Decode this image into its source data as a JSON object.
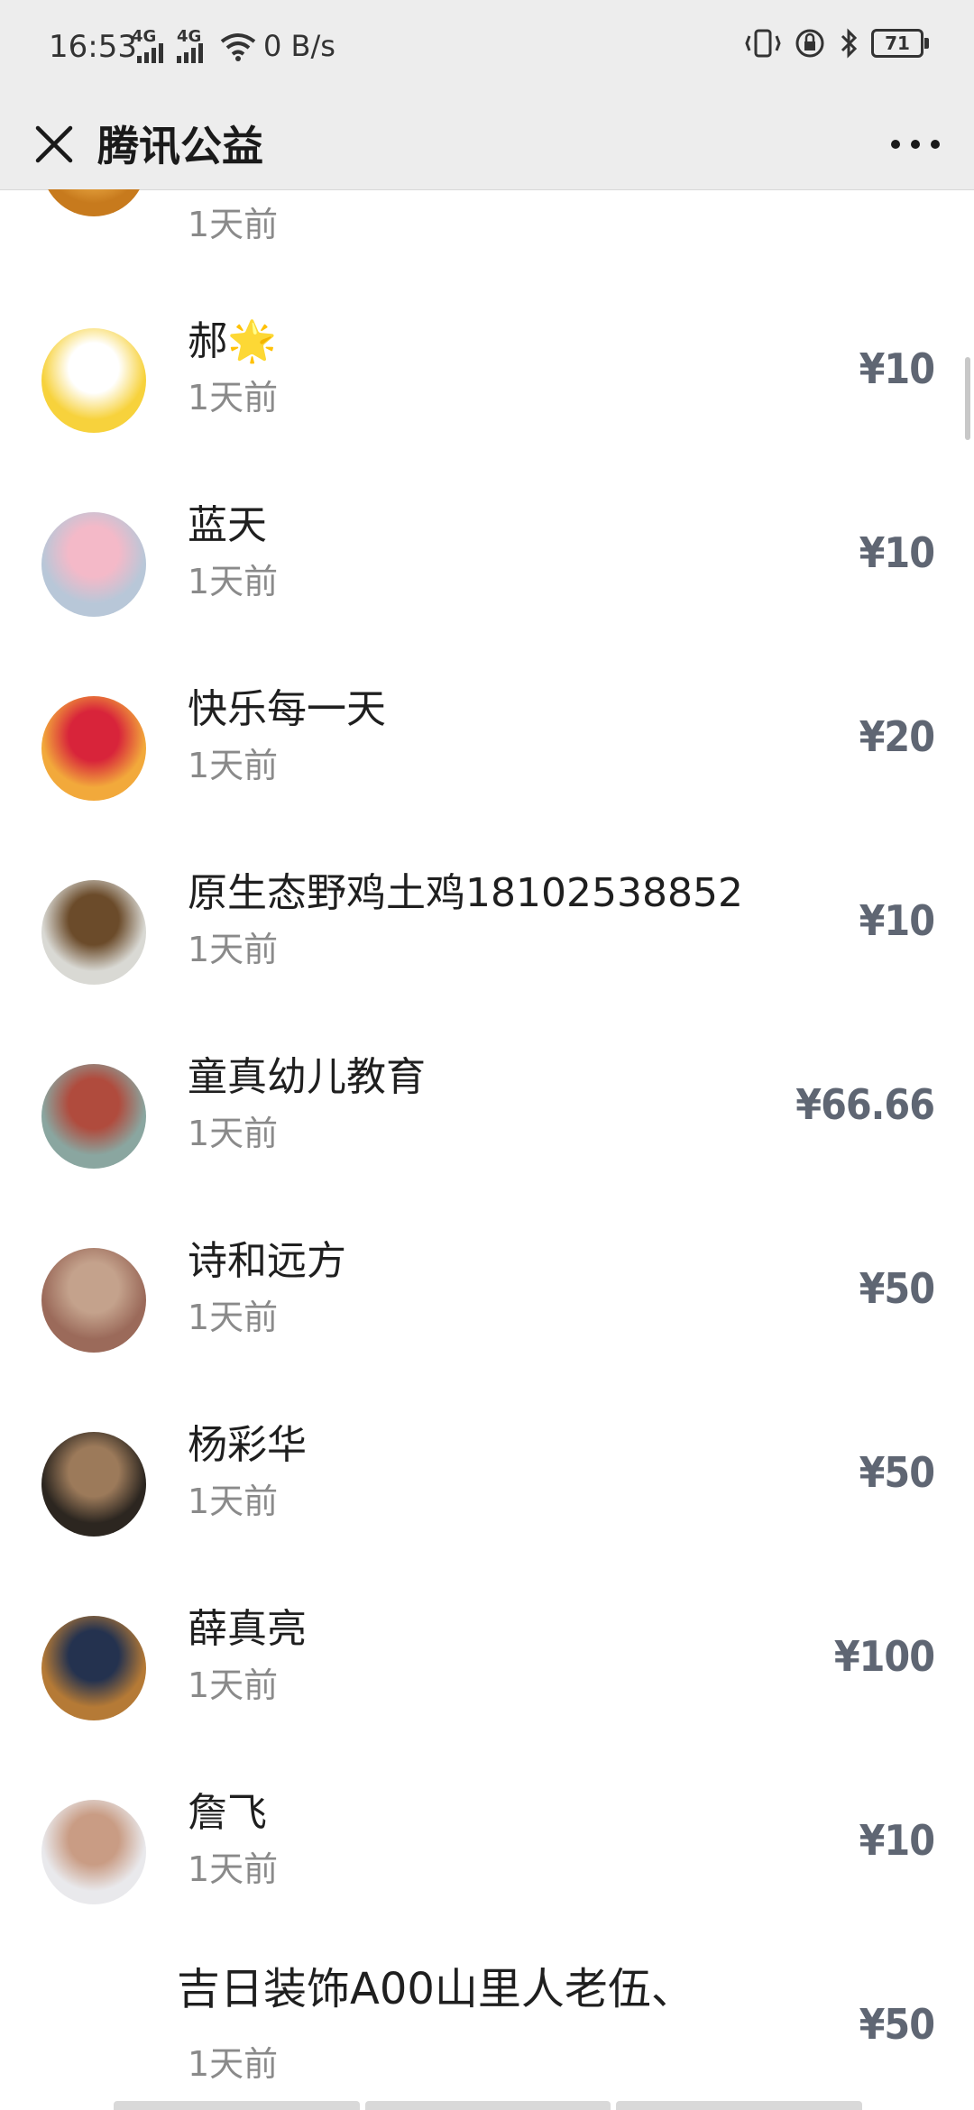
{
  "status_bar": {
    "time": "16:53",
    "network1": "4G",
    "network2": "4G",
    "speed": "0 B/s",
    "battery": "71"
  },
  "nav": {
    "title": "腾讯公益"
  },
  "donations": [
    {
      "name": "",
      "time": "1天前",
      "amount": "",
      "avatar_colors": [
        "#c77a1d",
        "#f0b04a"
      ]
    },
    {
      "name": "郝🌟",
      "time": "1天前",
      "amount": "¥10",
      "avatar_colors": [
        "#f7d23c",
        "#ffffff"
      ]
    },
    {
      "name": "蓝天",
      "time": "1天前",
      "amount": "¥10",
      "avatar_colors": [
        "#b8c7d8",
        "#f4b9c8"
      ]
    },
    {
      "name": "快乐每一天",
      "time": "1天前",
      "amount": "¥20",
      "avatar_colors": [
        "#f2a93b",
        "#d8243a"
      ]
    },
    {
      "name": "原生态野鸡土鸡18102538852",
      "time": "1天前",
      "amount": "¥10",
      "avatar_colors": [
        "#d9d9d4",
        "#6b4b2a"
      ]
    },
    {
      "name": "童真幼儿教育",
      "time": "1天前",
      "amount": "¥66.66",
      "avatar_colors": [
        "#8aa6a0",
        "#b04b3d"
      ]
    },
    {
      "name": "诗和远方",
      "time": "1天前",
      "amount": "¥50",
      "avatar_colors": [
        "#9b6a5a",
        "#c4a28c"
      ]
    },
    {
      "name": "杨彩华",
      "time": "1天前",
      "amount": "¥50",
      "avatar_colors": [
        "#2c2620",
        "#9c7a5a"
      ]
    },
    {
      "name": "薛真亮",
      "time": "1天前",
      "amount": "¥100",
      "avatar_colors": [
        "#b57a36",
        "#24324f"
      ]
    },
    {
      "name": "詹飞",
      "time": "1天前",
      "amount": "¥10",
      "avatar_colors": [
        "#e9e9ec",
        "#c99c84"
      ]
    },
    {
      "name": "吉日装饰A00山里人老伍、",
      "time": "1天前",
      "amount": "¥50",
      "avatar_colors": [
        "#ffffff",
        "#ffffff"
      ]
    }
  ]
}
